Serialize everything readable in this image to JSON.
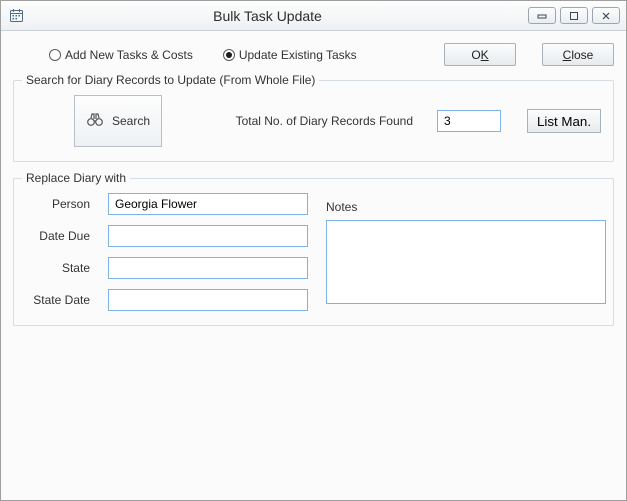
{
  "window": {
    "title": "Bulk Task Update"
  },
  "radios": {
    "add_label": "Add New Tasks & Costs",
    "update_label": "Update Existing Tasks",
    "selected": "update"
  },
  "buttons": {
    "ok_pre": "O",
    "ok_ul": "K",
    "close_pre": "",
    "close_ul": "C",
    "close_post": "lose",
    "search": "Search",
    "listman_pre": "",
    "listman_ul": "L",
    "listman_post": "ist Man."
  },
  "searchGroup": {
    "legend": "Search for Diary Records to Update (From Whole File)",
    "total_label": "Total No. of Diary Records Found",
    "count": "3"
  },
  "replaceGroup": {
    "legend": "Replace Diary with",
    "person_label": "Person",
    "person_value": "Georgia Flower",
    "date_due_label": "Date Due",
    "date_due_value": "",
    "state_label": "State",
    "state_value": "",
    "state_date_label": "State Date",
    "state_date_value": "",
    "notes_label": "Notes",
    "notes_value": ""
  }
}
